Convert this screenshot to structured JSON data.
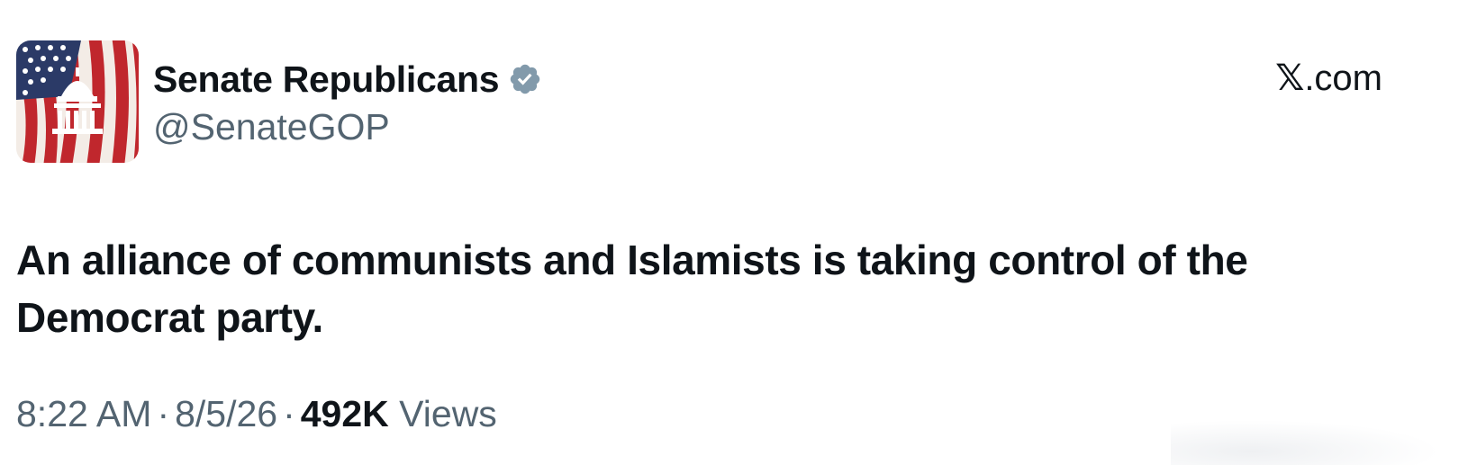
{
  "author": {
    "display_name": "Senate Republicans",
    "handle": "@SenateGOP",
    "verified": true,
    "verified_color": "#829aab",
    "avatar_icon": "capitol-flag-avatar-icon"
  },
  "source": {
    "logo": "𝕏",
    "label": ".com"
  },
  "tweet": {
    "text": "An alliance of communists and Islamists is taking control of the Democrat party."
  },
  "meta": {
    "time": "8:22 AM",
    "date": "8/5/26",
    "separator": "·",
    "views_count": "492K",
    "views_label": "Views"
  },
  "colors": {
    "text_primary": "#0f1419",
    "text_secondary": "#536471"
  }
}
